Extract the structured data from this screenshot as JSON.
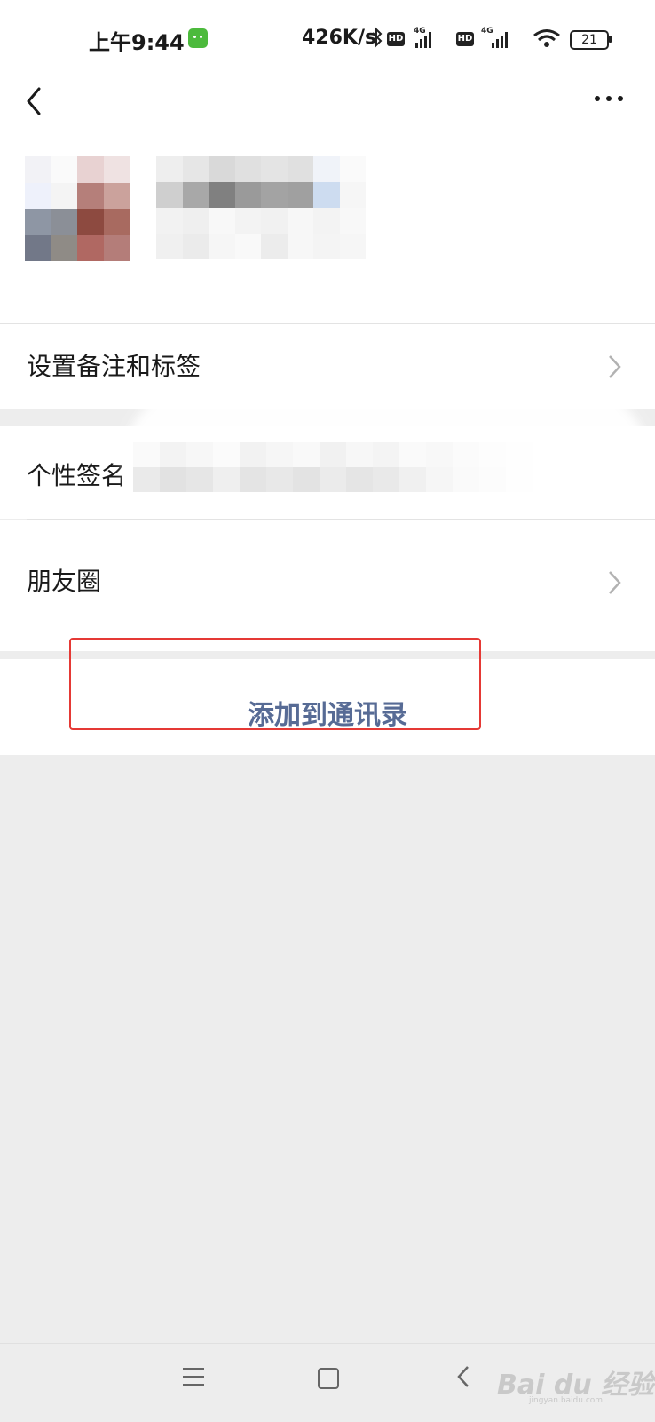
{
  "status_bar": {
    "time": "上午9:44",
    "net_speed": "426K/s",
    "hd_badge_1": "HD",
    "net_type_1": "4G",
    "hd_badge_2": "HD",
    "net_type_2": "4G",
    "battery_level": "21",
    "icons": [
      "app-notification-icon",
      "bluetooth-icon",
      "signal-icon",
      "wifi-icon",
      "battery-icon"
    ]
  },
  "header": {
    "back_icon": "back-chevron-icon",
    "more_icon": "more-dots-icon"
  },
  "rows": {
    "set_remark": "设置备注和标签",
    "signature": "个性签名",
    "moments": "朋友圈"
  },
  "action": {
    "add_to_contacts": "添加到通讯录"
  },
  "nav_bar": {
    "icons": [
      "menu-icon",
      "home-icon",
      "back-icon"
    ]
  },
  "watermark": {
    "text": "Bai du 经验",
    "sub": "jingyan.baidu.com"
  },
  "colors": {
    "link_blue": "#576b95",
    "highlight_red": "#e53935",
    "background": "#ededed",
    "wechat_green": "#4cba3c"
  }
}
